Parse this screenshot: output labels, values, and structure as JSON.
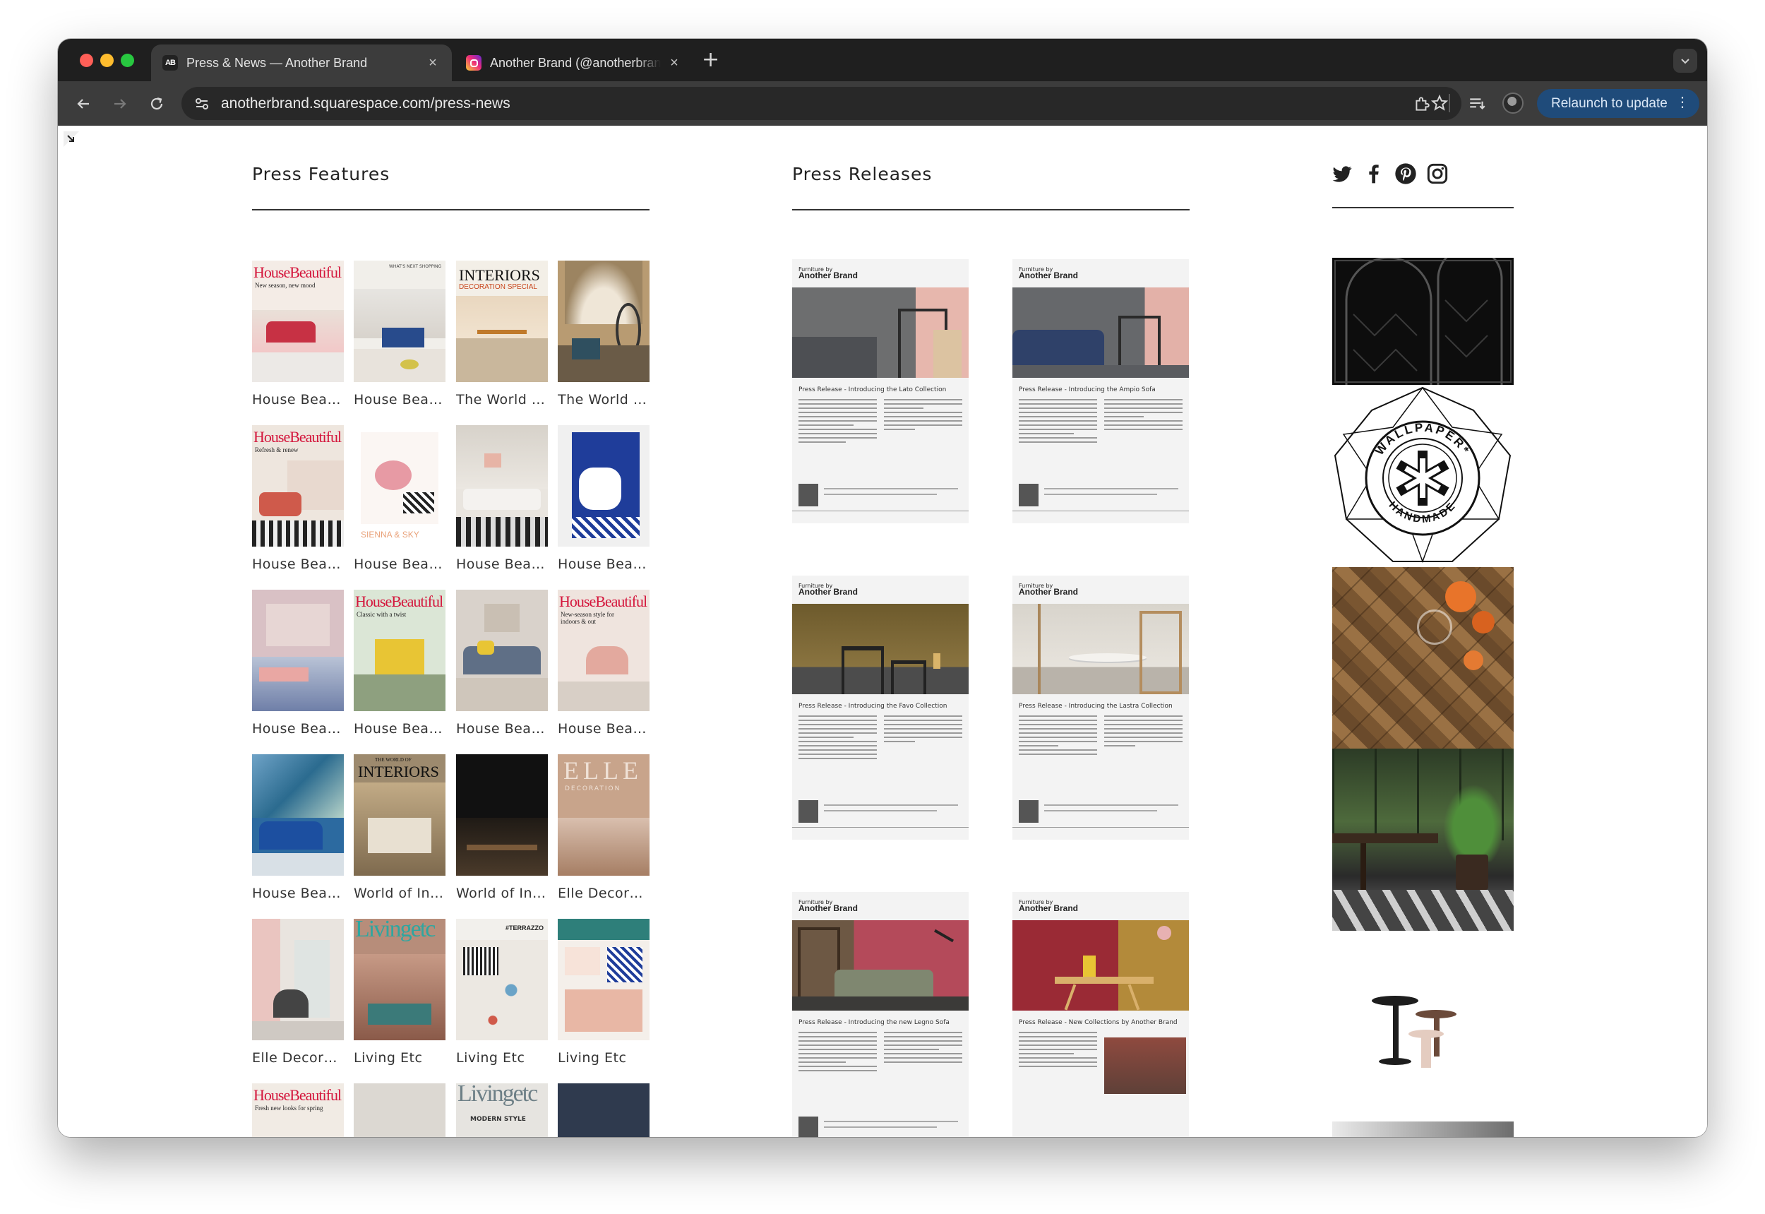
{
  "browser": {
    "tabs": [
      {
        "title": "Press & News — Another Brand",
        "favicon": "AB",
        "active": true
      },
      {
        "title": "Another Brand (@anotherbrand)",
        "favicon": "instagram-icon",
        "active": false
      }
    ],
    "url": "anotherbrand.squarespace.com/press-news",
    "relaunch_label": "Relaunch to update"
  },
  "page": {
    "press_features_heading": "Press Features",
    "press_releases_heading": "Press Releases",
    "social_icons": [
      "twitter-icon",
      "facebook-icon",
      "pinterest-icon",
      "instagram-icon"
    ],
    "press_features": [
      {
        "caption": "House Beautiful",
        "cover_title": "HouseBeautiful",
        "cover_sub": "New season, new mood"
      },
      {
        "caption": "House Beautiful",
        "cover_title": "",
        "cover_sub": "WHAT'S NEXT SHOPPING"
      },
      {
        "caption": "The World of Interiors",
        "cover_title": "INTERIORS",
        "cover_sub": "DECORATION SPECIAL"
      },
      {
        "caption": "The World of Interiors",
        "cover_title": "",
        "cover_sub": ""
      },
      {
        "caption": "House Beautiful",
        "cover_title": "HouseBeautiful",
        "cover_sub": "Refresh & renew"
      },
      {
        "caption": "House Beautiful",
        "cover_title": "",
        "cover_sub": "SIENNA & SKY"
      },
      {
        "caption": "House Beautiful",
        "cover_title": "",
        "cover_sub": ""
      },
      {
        "caption": "House Beautiful",
        "cover_title": "",
        "cover_sub": ""
      },
      {
        "caption": "House Beautiful",
        "cover_title": "",
        "cover_sub": ""
      },
      {
        "caption": "House Beautiful",
        "cover_title": "HouseBeautiful",
        "cover_sub": "Classic with a twist"
      },
      {
        "caption": "House Beautiful",
        "cover_title": "",
        "cover_sub": ""
      },
      {
        "caption": "House Beautiful",
        "cover_title": "HouseBeautiful",
        "cover_sub": "New-season style for indoors & out"
      },
      {
        "caption": "House Beautiful",
        "cover_title": "",
        "cover_sub": ""
      },
      {
        "caption": "World of Interiors",
        "cover_title": "INTERIORS",
        "cover_sub": "THE WORLD OF"
      },
      {
        "caption": "World of Interiors",
        "cover_title": "",
        "cover_sub": ""
      },
      {
        "caption": "Elle Decoration",
        "cover_title": "ELLE",
        "cover_sub": "DECORATION"
      },
      {
        "caption": "Elle Decoration",
        "cover_title": "",
        "cover_sub": ""
      },
      {
        "caption": "Living Etc",
        "cover_title": "Livingetc",
        "cover_sub": ""
      },
      {
        "caption": "Living Etc",
        "cover_title": "",
        "cover_sub": "#TERRAZZO"
      },
      {
        "caption": "Living Etc",
        "cover_title": "",
        "cover_sub": ""
      },
      {
        "caption": "House Beautiful",
        "cover_title": "HouseBeautiful",
        "cover_sub": "Fresh new looks for spring"
      },
      {
        "caption": "",
        "cover_title": "",
        "cover_sub": ""
      },
      {
        "caption": "",
        "cover_title": "Livingetc",
        "cover_sub": "MODERN STYLE"
      },
      {
        "caption": "",
        "cover_title": "",
        "cover_sub": ""
      }
    ],
    "press_release_brand_kicker": "Furniture by",
    "press_release_brand": "Another Brand",
    "press_releases": [
      {
        "subtitle": "Press Release - Introducing the Lato Collection"
      },
      {
        "subtitle": "Press Release - Introducing the Ampio Sofa"
      },
      {
        "subtitle": "Press Release - Introducing the Favo Collection"
      },
      {
        "subtitle": "Press Release - Introducing the Lastra Collection"
      },
      {
        "subtitle": "Press Release - Introducing the new Legno Sofa"
      },
      {
        "subtitle": "Press Release - New Collections by Another Brand"
      }
    ],
    "sidebar_badge_text_top": "WALLPAPER*",
    "sidebar_badge_text_bottom": "HANDMADE"
  },
  "colors": {
    "chrome_dark": "#1f1f1f",
    "chrome_toolbar": "#3c3c3c",
    "relaunch_bg": "#1f4b7a",
    "house_beautiful_red": "#d4163c",
    "text": "#222222"
  }
}
